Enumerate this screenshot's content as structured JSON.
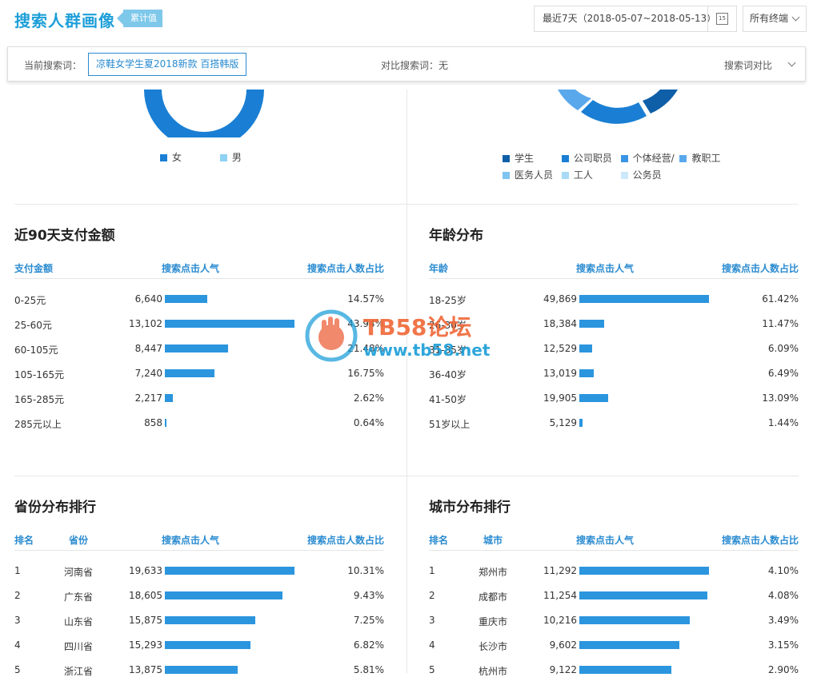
{
  "header": {
    "title": "搜索人群画像",
    "badge": "累计值",
    "date_range": "最近7天（2018-05-07~2018-05-13）",
    "calendar_day": "15",
    "terminal": "所有终端"
  },
  "search_bar": {
    "current_label": "当前搜索词：",
    "current_term": "凉鞋女学生夏2018新款 百搭韩版",
    "compare_label": "对比搜索词：无",
    "compare_button": "搜索词对比"
  },
  "colors": {
    "accent": "#2a8bd0",
    "bar": "#2b95de"
  },
  "gender_legend": [
    {
      "label": "女",
      "color": "#1a7fd4"
    },
    {
      "label": "男",
      "color": "#8fd2f4"
    }
  ],
  "occupation_legend": [
    {
      "label": "学生",
      "color": "#0e5fa8"
    },
    {
      "label": "公司职员",
      "color": "#1a7fd4"
    },
    {
      "label": "个体经营/",
      "color": "#3a95e4"
    },
    {
      "label": "教职工",
      "color": "#5aa8ec"
    },
    {
      "label": "医务人员",
      "color": "#7ec4f0"
    },
    {
      "label": "工人",
      "color": "#a8daf6"
    },
    {
      "label": "公务员",
      "color": "#cbe9fa"
    }
  ],
  "payment": {
    "title": "近90天支付金额",
    "headers": [
      "支付金额",
      "搜索点击人气",
      "搜索点击人数占比"
    ],
    "rows": [
      {
        "label": "0-25元",
        "value": "6,640",
        "share": "14.57%",
        "level": 0.33
      },
      {
        "label": "25-60元",
        "value": "13,102",
        "share": "43.94%",
        "level": 1.0
      },
      {
        "label": "60-105元",
        "value": "8,447",
        "share": "21.48%",
        "level": 0.49
      },
      {
        "label": "105-165元",
        "value": "7,240",
        "share": "16.75%",
        "level": 0.38
      },
      {
        "label": "165-285元",
        "value": "2,217",
        "share": "2.62%",
        "level": 0.06
      },
      {
        "label": "285元以上",
        "value": "858",
        "share": "0.64%",
        "level": 0.015
      }
    ]
  },
  "age": {
    "title": "年龄分布",
    "headers": [
      "年龄",
      "搜索点击人气",
      "搜索点击人数占比"
    ],
    "rows": [
      {
        "label": "18-25岁",
        "value": "49,869",
        "share": "61.42%",
        "level": 1.0
      },
      {
        "label": "26-30岁",
        "value": "18,384",
        "share": "11.47%",
        "level": 0.19
      },
      {
        "label": "31-35岁",
        "value": "12,529",
        "share": "6.09%",
        "level": 0.1
      },
      {
        "label": "36-40岁",
        "value": "13,019",
        "share": "6.49%",
        "level": 0.11
      },
      {
        "label": "41-50岁",
        "value": "19,905",
        "share": "13.09%",
        "level": 0.22
      },
      {
        "label": "51岁以上",
        "value": "5,129",
        "share": "1.44%",
        "level": 0.025
      }
    ]
  },
  "province": {
    "title": "省份分布排行",
    "headers": [
      "排名",
      "省份",
      "搜索点击人气",
      "搜索点击人数占比"
    ],
    "rows": [
      {
        "rank": "1",
        "name": "河南省",
        "value": "19,633",
        "share": "10.31%",
        "level": 1.0
      },
      {
        "rank": "2",
        "name": "广东省",
        "value": "18,605",
        "share": "9.43%",
        "level": 0.91
      },
      {
        "rank": "3",
        "name": "山东省",
        "value": "15,875",
        "share": "7.25%",
        "level": 0.7
      },
      {
        "rank": "4",
        "name": "四川省",
        "value": "15,293",
        "share": "6.82%",
        "level": 0.66
      },
      {
        "rank": "5",
        "name": "浙江省",
        "value": "13,875",
        "share": "5.81%",
        "level": 0.56
      }
    ]
  },
  "city": {
    "title": "城市分布排行",
    "headers": [
      "排名",
      "城市",
      "搜索点击人气",
      "搜索点击人数占比"
    ],
    "rows": [
      {
        "rank": "1",
        "name": "郑州市",
        "value": "11,292",
        "share": "4.10%",
        "level": 1.0
      },
      {
        "rank": "2",
        "name": "成都市",
        "value": "11,254",
        "share": "4.08%",
        "level": 0.99
      },
      {
        "rank": "3",
        "name": "重庆市",
        "value": "10,216",
        "share": "3.49%",
        "level": 0.85
      },
      {
        "rank": "4",
        "name": "长沙市",
        "value": "9,602",
        "share": "3.15%",
        "level": 0.77
      },
      {
        "rank": "5",
        "name": "杭州市",
        "value": "9,122",
        "share": "2.90%",
        "level": 0.71
      }
    ]
  },
  "watermark": {
    "line1": "TB58论坛",
    "line2": "www.tb58.net"
  }
}
